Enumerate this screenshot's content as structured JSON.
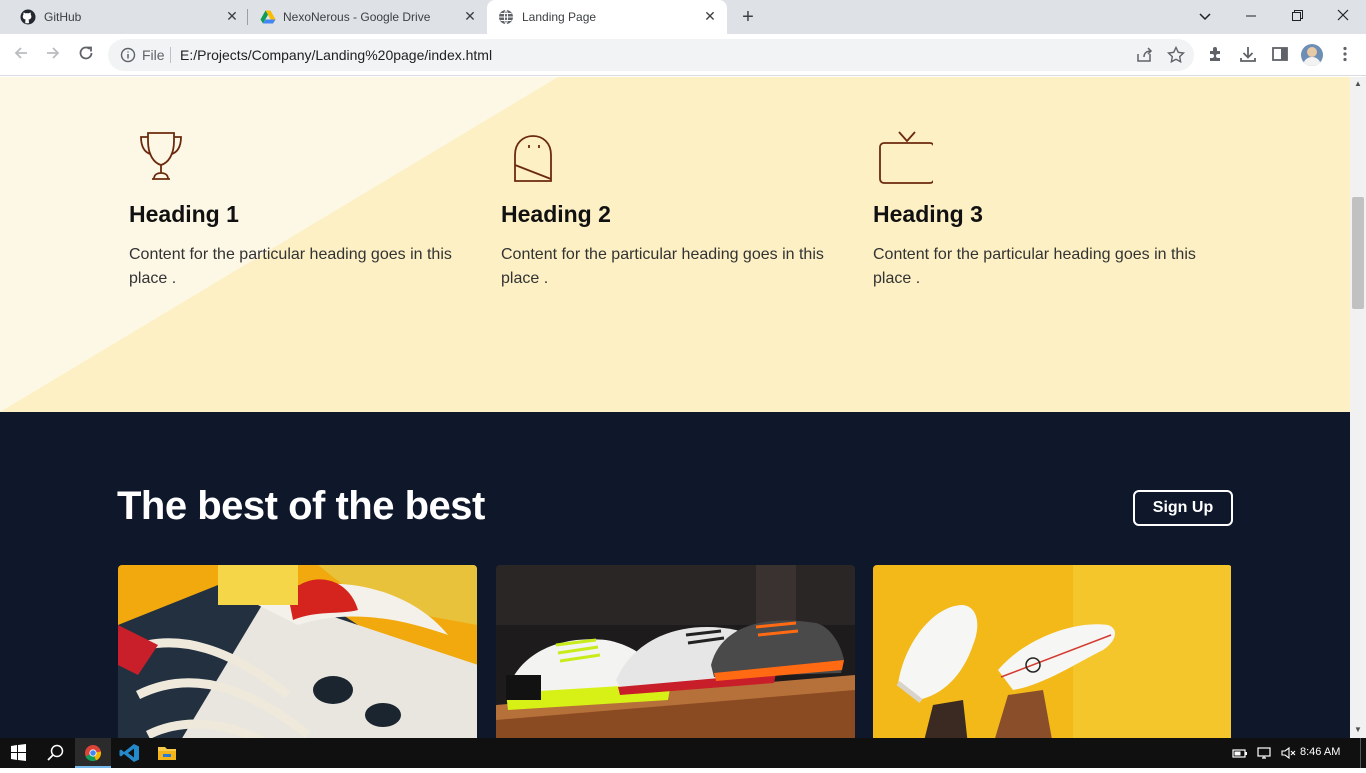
{
  "browser": {
    "tabs": [
      {
        "title": "GitHub",
        "icon": "github-icon"
      },
      {
        "title": "NexoNerous - Google Drive",
        "icon": "google-drive-icon"
      },
      {
        "title": "Landing Page",
        "icon": "globe-icon",
        "active": true
      }
    ],
    "address": {
      "scheme_label": "File",
      "url": "E:/Projects/Company/Landing%20page/index.html"
    }
  },
  "page": {
    "features": [
      {
        "icon": "trophy-icon",
        "heading": "Heading 1",
        "text": "Content for the particular heading goes in this place ."
      },
      {
        "icon": "dome-icon",
        "heading": "Heading 2",
        "text": "Content for the particular heading goes in this place ."
      },
      {
        "icon": "tv-icon",
        "heading": "Heading 3",
        "text": "Content for the particular heading goes in this place ."
      }
    ],
    "best": {
      "title": "The best of the best",
      "signup_label": "Sign Up",
      "cards": [
        "shoe-photo-1",
        "shoe-photo-2",
        "shoe-photo-3"
      ]
    }
  },
  "taskbar": {
    "time": "8:46 AM"
  },
  "colors": {
    "features_bg": "#fcf0c4",
    "dark_bg": "#0f172b",
    "icon_stroke": "#6b2a0e"
  }
}
